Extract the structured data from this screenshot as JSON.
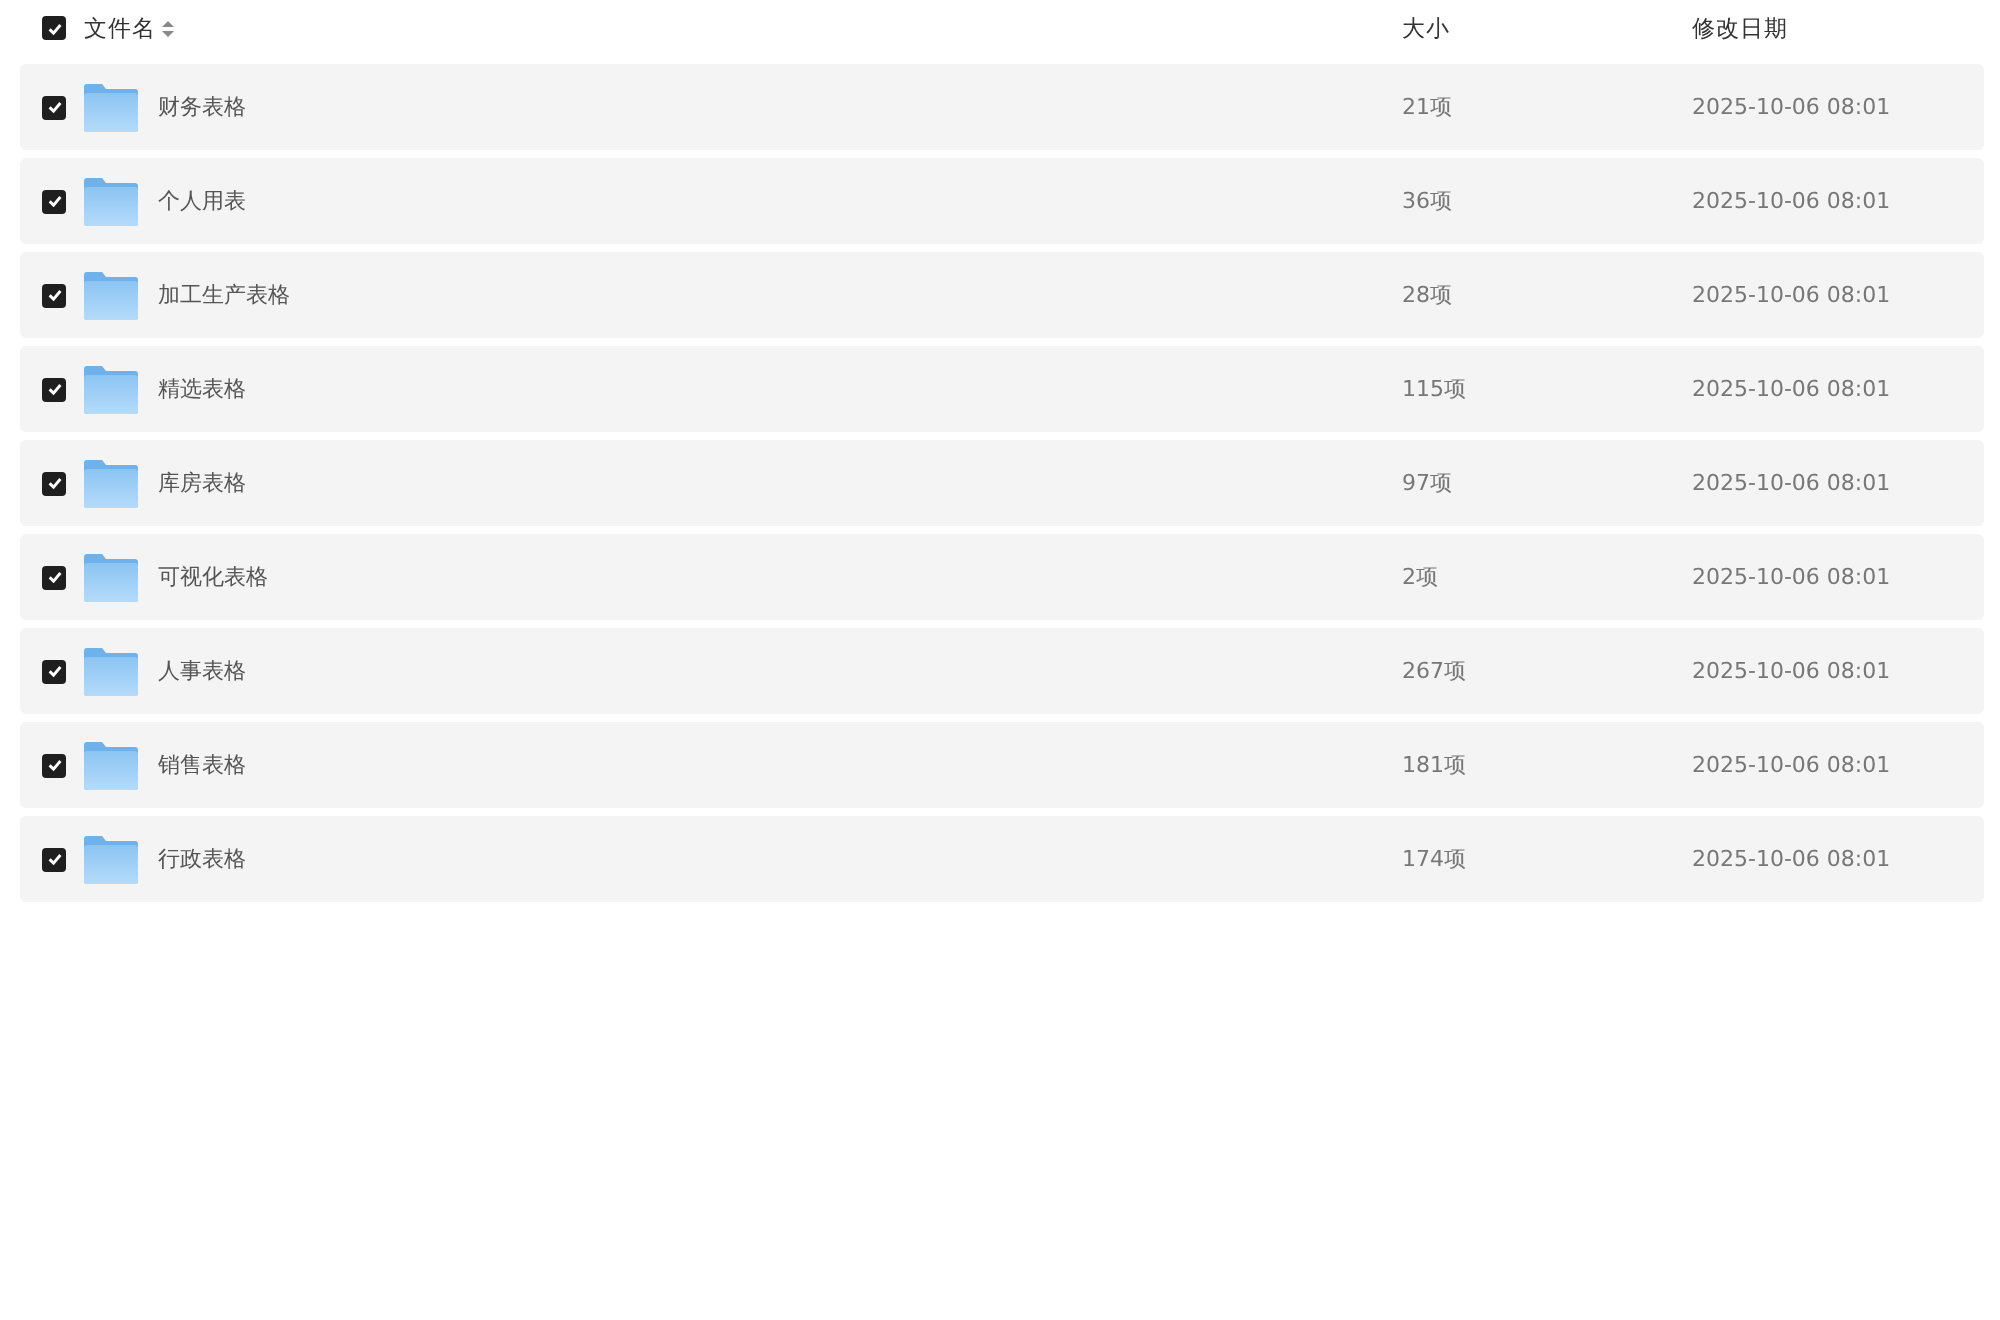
{
  "header": {
    "checked": true,
    "columns": [
      "文件名",
      "大小",
      "修改日期"
    ]
  },
  "rows": [
    {
      "name": "财务表格",
      "size": "21项",
      "date": "2025-10-06 08:01",
      "checked": true
    },
    {
      "name": "个人用表",
      "size": "36项",
      "date": "2025-10-06 08:01",
      "checked": true
    },
    {
      "name": "加工生产表格",
      "size": "28项",
      "date": "2025-10-06 08:01",
      "checked": true
    },
    {
      "name": "精选表格",
      "size": "115项",
      "date": "2025-10-06 08:01",
      "checked": true
    },
    {
      "name": "库房表格",
      "size": "97项",
      "date": "2025-10-06 08:01",
      "checked": true
    },
    {
      "name": "可视化表格",
      "size": "2项",
      "date": "2025-10-06 08:01",
      "checked": true
    },
    {
      "name": "人事表格",
      "size": "267项",
      "date": "2025-10-06 08:01",
      "checked": true
    },
    {
      "name": "销售表格",
      "size": "181项",
      "date": "2025-10-06 08:01",
      "checked": true
    },
    {
      "name": "行政表格",
      "size": "174项",
      "date": "2025-10-06 08:01",
      "checked": true
    }
  ]
}
